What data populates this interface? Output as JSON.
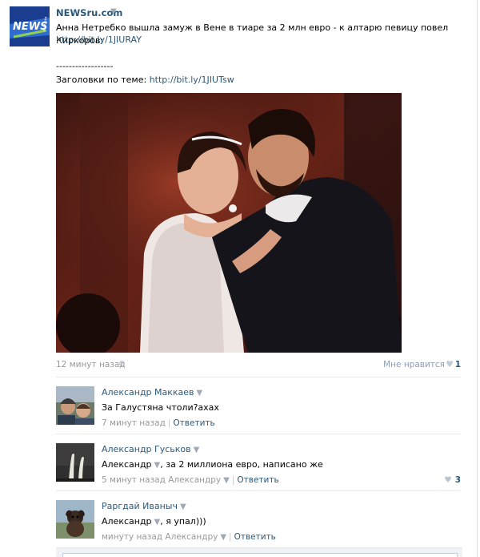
{
  "post": {
    "author": "NEWSru.com",
    "logo_text": "NEWS",
    "text": "Анна Нетребко вышла замуж в Вене в тиаре за 2 млн евро - к алтарю певицу повел Киркоров:",
    "link1": "http://bit.ly/1JIURAY",
    "dashes": "------------------",
    "related_label": "Заголовки по теме:",
    "link2": "http://bit.ly/1JIUTsw",
    "time": "12 минут назад",
    "like_label": "Мне нравится",
    "like_count": "1"
  },
  "comments": [
    {
      "author": "Александр Маккаев",
      "text": "За Галустяна чтоли?ахах",
      "time": "7 минут назад",
      "reply_to": "",
      "reply_label": "Ответить",
      "likes": ""
    },
    {
      "author": "Александр Гуськов",
      "mention": "Александр",
      "text": ", за 2 миллиона евро, написано же",
      "time": "5 минут назад",
      "reply_to": "Александру",
      "reply_label": "Ответить",
      "likes": "3"
    },
    {
      "author": "Раргдай Иваныч",
      "mention": "Александр",
      "text": ", я упал)))",
      "time": "минуту назад",
      "reply_to": "Александру",
      "reply_label": "Ответить",
      "likes": ""
    }
  ],
  "colors": {
    "link": "#2b587a",
    "muted": "#999999",
    "separator": "#e7eaed",
    "logo_blue": "#1b3d8f"
  },
  "icons": {
    "gear": "gear-icon",
    "heart": "heart-icon",
    "arrow": "dropdown-arrow-icon"
  }
}
